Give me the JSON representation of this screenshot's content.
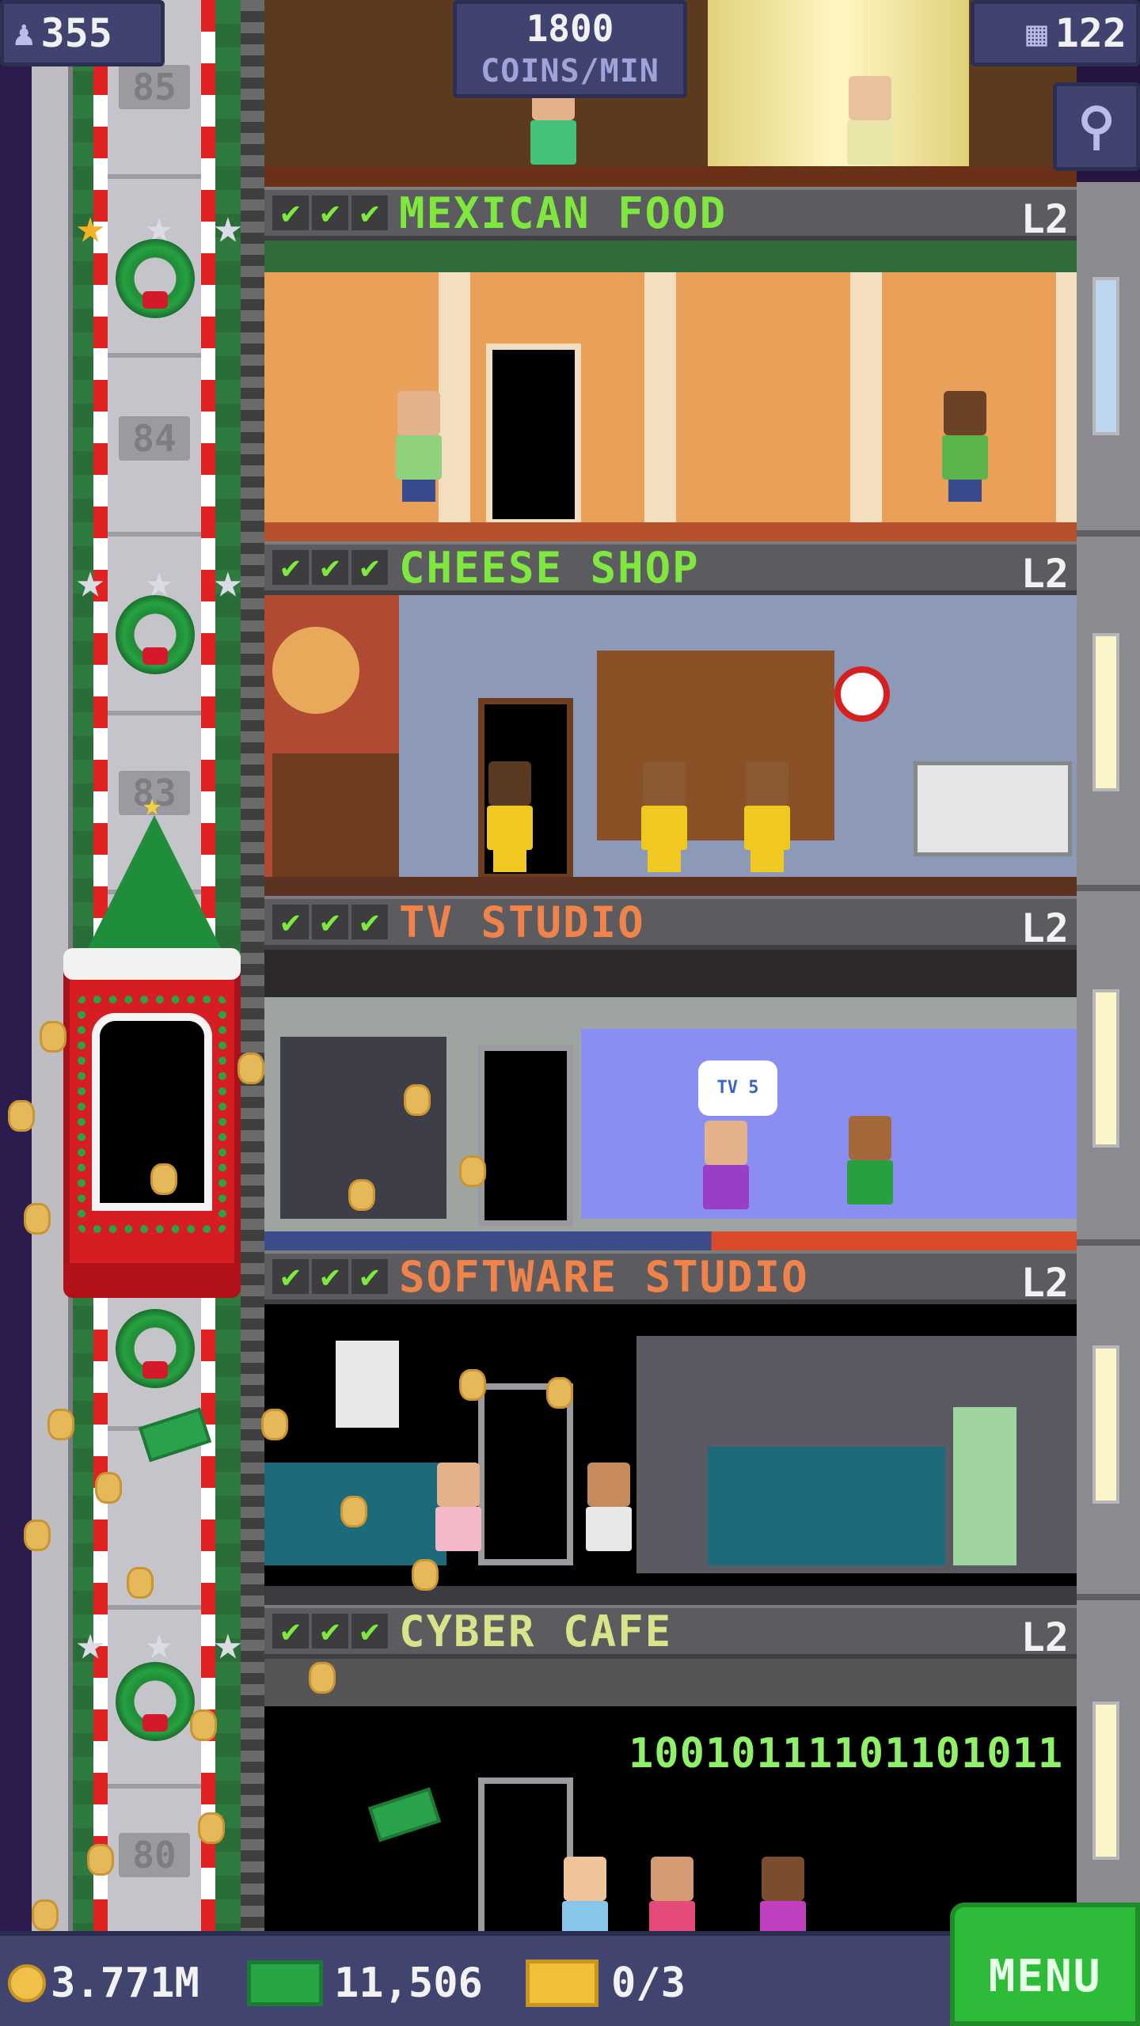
{
  "hud": {
    "population": "355",
    "population_icon": "person-icon",
    "coins_per_min_value": "1800",
    "coins_per_min_unit": "COINS/MIN",
    "tower_bux_floors": "122",
    "floors_icon": "building-icon",
    "search_icon": "magnifier-icon"
  },
  "elevator": {
    "floor_numbers": [
      "85",
      "84",
      "83",
      "80"
    ]
  },
  "floors": [
    {
      "name": "MEXICAN FOOD",
      "level": "L2",
      "checks": [
        "✔",
        "✔",
        "✔"
      ],
      "name_color": "#7fe83e"
    },
    {
      "name": "CHEESE SHOP",
      "level": "L2",
      "checks": [
        "✔",
        "✔",
        "✔"
      ],
      "name_color": "#7fe83e"
    },
    {
      "name": "TV STUDIO",
      "level": "L2",
      "checks": [
        "✔",
        "✔",
        "✔"
      ],
      "name_color": "#f0834a"
    },
    {
      "name": "SOFTWARE STUDIO",
      "level": "L2",
      "checks": [
        "✔",
        "✔",
        "✔"
      ],
      "name_color": "#f0834a"
    },
    {
      "name": "CYBER CAFE",
      "level": "L2",
      "checks": [
        "✔",
        "✔",
        "✔"
      ],
      "name_color": "#d9e38a"
    }
  ],
  "cyber_cafe_sign": "10010111101101011",
  "tv_badge": "TV 5",
  "bottom_bar": {
    "coins": "3.771M",
    "bux": "11,506",
    "tickets": "0/3",
    "menu_label": "MENU"
  },
  "colors": {
    "hud_bg": "#40436f",
    "menu_green": "#2fbb3a",
    "check_green": "#7fe83e"
  }
}
